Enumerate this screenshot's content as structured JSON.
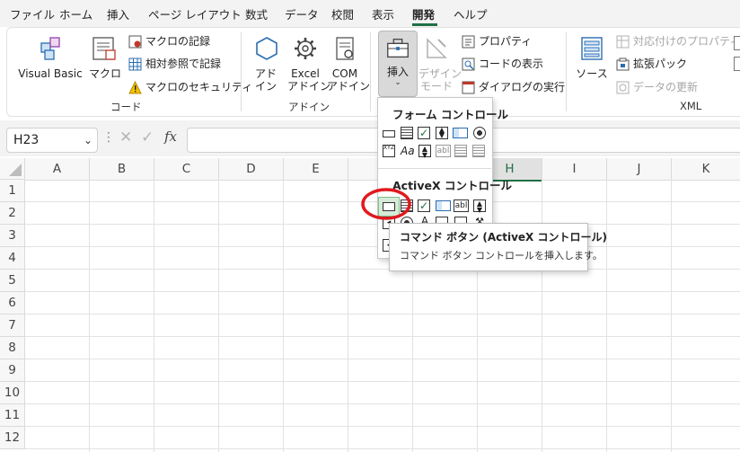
{
  "menu": {
    "tabs": [
      "ファイル",
      "ホーム",
      "挿入",
      "ページ レイアウト",
      "数式",
      "データ",
      "校閲",
      "表示",
      "開発",
      "ヘルプ"
    ],
    "active": "開発"
  },
  "ribbon": {
    "groups": {
      "code": {
        "label": "コード",
        "visual_basic": "Visual Basic",
        "macro": "マクロ",
        "record_macro": "マクロの記録",
        "relative_ref": "相対参照で記録",
        "macro_security": "マクロのセキュリティ"
      },
      "addins": {
        "label": "アドイン",
        "addin": [
          "アド",
          "イン"
        ],
        "excel_addin": [
          "Excel",
          "アドイン"
        ],
        "com_addin": [
          "COM",
          "アドイン"
        ]
      },
      "controls": {
        "insert": "挿入",
        "design_mode": [
          "デザイン",
          "モード"
        ],
        "properties": "プロパティ",
        "view_code": "コードの表示",
        "run_dialog": "ダイアログの実行"
      },
      "xml": {
        "label": "XML",
        "source": "ソース",
        "map_properties": "対応付けのプロパティ",
        "expansion_packs": "拡張パック",
        "refresh_data": "データの更新"
      }
    }
  },
  "formula_bar": {
    "name_box": "H23",
    "fx": "fx",
    "value": ""
  },
  "grid": {
    "columns": [
      "A",
      "B",
      "C",
      "D",
      "E",
      "F",
      "G",
      "H",
      "I",
      "J",
      "K"
    ],
    "rows": [
      "1",
      "2",
      "3",
      "4",
      "5",
      "6",
      "7",
      "8",
      "9",
      "10",
      "11",
      "12"
    ],
    "selected_column": "H"
  },
  "insert_dropdown": {
    "form_controls_header": "フォーム コントロール",
    "activex_header": "ActiveX コントロール"
  },
  "tooltip": {
    "title": "コマンド ボタン (ActiveX コントロール)",
    "description": "コマンド ボタン コントロールを挿入します。"
  },
  "colors": {
    "accent_green": "#1e7145",
    "highlight_red": "#e0191f",
    "icon_blue": "#2b6cb0"
  }
}
